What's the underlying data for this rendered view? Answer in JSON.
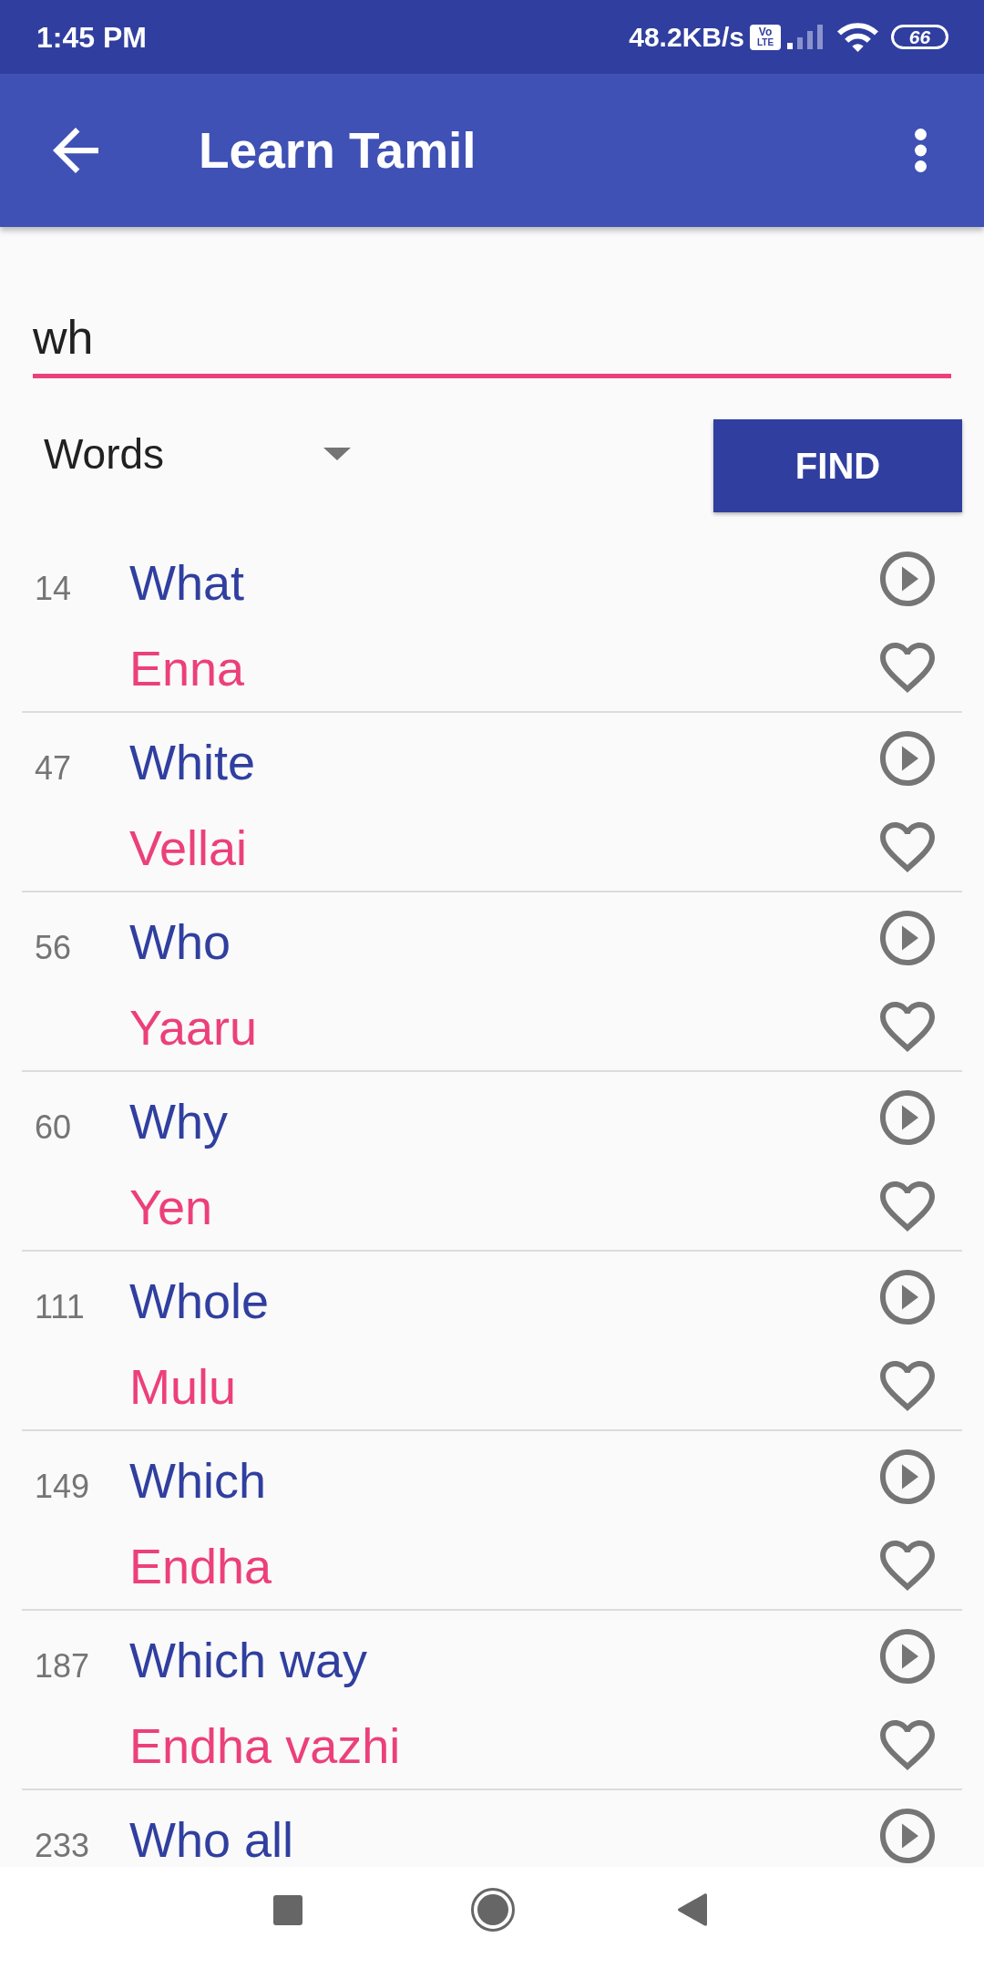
{
  "status_bar": {
    "time": "1:45 PM",
    "network_speed": "48.2KB/s",
    "volte_badge": {
      "line_1": "Vo",
      "line_2": "LTE"
    },
    "battery": "66"
  },
  "app_bar": {
    "title": "Learn Tamil"
  },
  "search": {
    "value": "wh"
  },
  "filter": {
    "value": "Words"
  },
  "find_button": {
    "label": "FIND"
  },
  "results": [
    {
      "number": "14",
      "word": "What",
      "translation": "Enna",
      "favorite": false
    },
    {
      "number": "47",
      "word": "White",
      "translation": "Vellai",
      "favorite": false
    },
    {
      "number": "56",
      "word": "Who",
      "translation": "Yaaru",
      "favorite": false
    },
    {
      "number": "60",
      "word": "Why",
      "translation": "Yen",
      "favorite": false
    },
    {
      "number": "111",
      "word": "Whole",
      "translation": "Mulu",
      "favorite": false
    },
    {
      "number": "149",
      "word": "Which",
      "translation": "Endha",
      "favorite": false
    },
    {
      "number": "187",
      "word": "Which way",
      "translation": "Endha vazhi",
      "favorite": false
    },
    {
      "number": "233",
      "word": "Who all"
    }
  ]
}
